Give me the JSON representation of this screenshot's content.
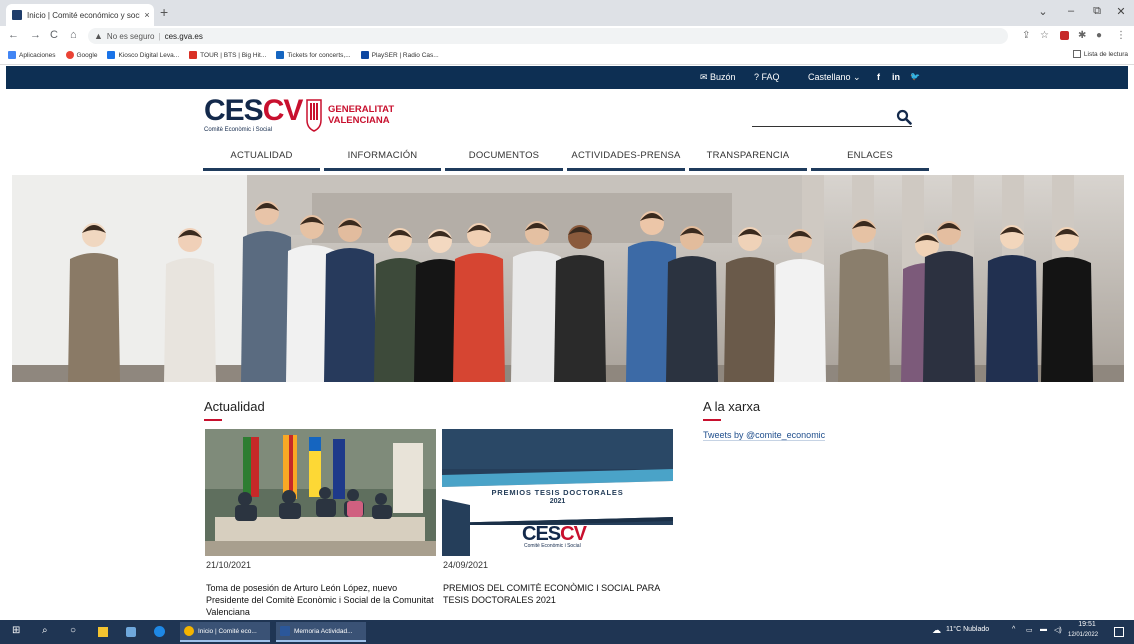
{
  "browser": {
    "tab_title": "Inicio | Comité económico y soci",
    "tab_close": "×",
    "new_tab": "+",
    "window_buttons": [
      "⌄",
      "–",
      "⧉",
      "✕"
    ],
    "nav": {
      "back": "←",
      "forward": "→",
      "reload": "C",
      "home": "⌂"
    },
    "security_text": "No es seguro",
    "url": "ces.gva.es"
  },
  "bookmarks": [
    {
      "label": "Aplicaciones",
      "color": "#4285f4"
    },
    {
      "label": "Google",
      "color": "#ea4335"
    },
    {
      "label": "Kiosco Digital Leva...",
      "color": "#1a73e8"
    },
    {
      "label": "TOUR | BTS | Big Hit...",
      "color": "#d93025"
    },
    {
      "label": "Tickets for concerts,...",
      "color": "#1565c0"
    },
    {
      "label": "PlaySER | Radio Cas...",
      "color": "#0d47a1"
    }
  ],
  "reading_list": "Lista de lectura",
  "site_top": {
    "buzon": "✉ Buzón",
    "faq": "? FAQ",
    "language": "Castellano ⌄",
    "social": [
      "f",
      "in",
      "🐦"
    ]
  },
  "logo": {
    "brand_main": "CES",
    "brand_accent": "CV",
    "brand_sub": "Comitè Econòmic i Social",
    "gv_line1": "GENERALITAT",
    "gv_line2": "VALENCIANA"
  },
  "menu": [
    "ACTUALIDAD",
    "INFORMACIÓN",
    "DOCUMENTOS",
    "ACTIVIDADES-PRENSA",
    "TRANSPARENCIA",
    "ENLACES"
  ],
  "sections": {
    "actualidad": "Actualidad",
    "xarxa": "A la xarxa",
    "tweets": "Tweets by @comite_economic"
  },
  "news": [
    {
      "date": "21/10/2021",
      "title": "Toma de posesión de Arturo León López, nuevo Presidente del Comitè Econòmic i Social de la Comunitat Valenciana"
    },
    {
      "date": "24/09/2021",
      "title": "PREMIOS DEL COMITÈ ECONÒMIC I SOCIAL PARA TESIS DOCTORALES 2021"
    }
  ],
  "premios_card": {
    "line1": "PREMIOS TESIS DOCTORALES",
    "line2": "2021",
    "brand_main": "CES",
    "brand_accent": "CV",
    "brand_sub": "Comitè Econòmic i Social"
  },
  "taskbar": {
    "apps": [
      {
        "label": "Inicio | Comité eco...",
        "color": "#f4b400"
      },
      {
        "label": "Memoria Actividad...",
        "color": "#2b579a"
      }
    ],
    "weather": "11°C Nublado",
    "time": "19:51",
    "date": "12/01/2022"
  },
  "colors": {
    "navy": "#0d2f53",
    "brand_red": "#c8102e",
    "brand_navy": "#13294b"
  }
}
